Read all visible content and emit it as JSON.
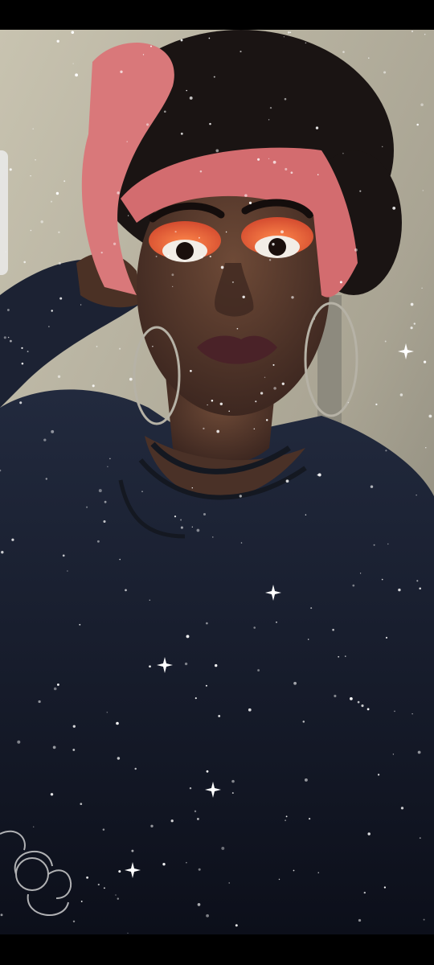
{
  "viewer": {
    "background": "#000000"
  },
  "photo": {
    "subject_palette": {
      "wall": "#bdb8a6",
      "skin": "#5a3d2e",
      "headwrap": "#d9787a",
      "eyeshadow": "#f06a3a",
      "lips": "#4a2228",
      "top": "#1c2233",
      "hair": "#1a1413"
    }
  },
  "overlay": {
    "effect": "sparkle-filter"
  }
}
